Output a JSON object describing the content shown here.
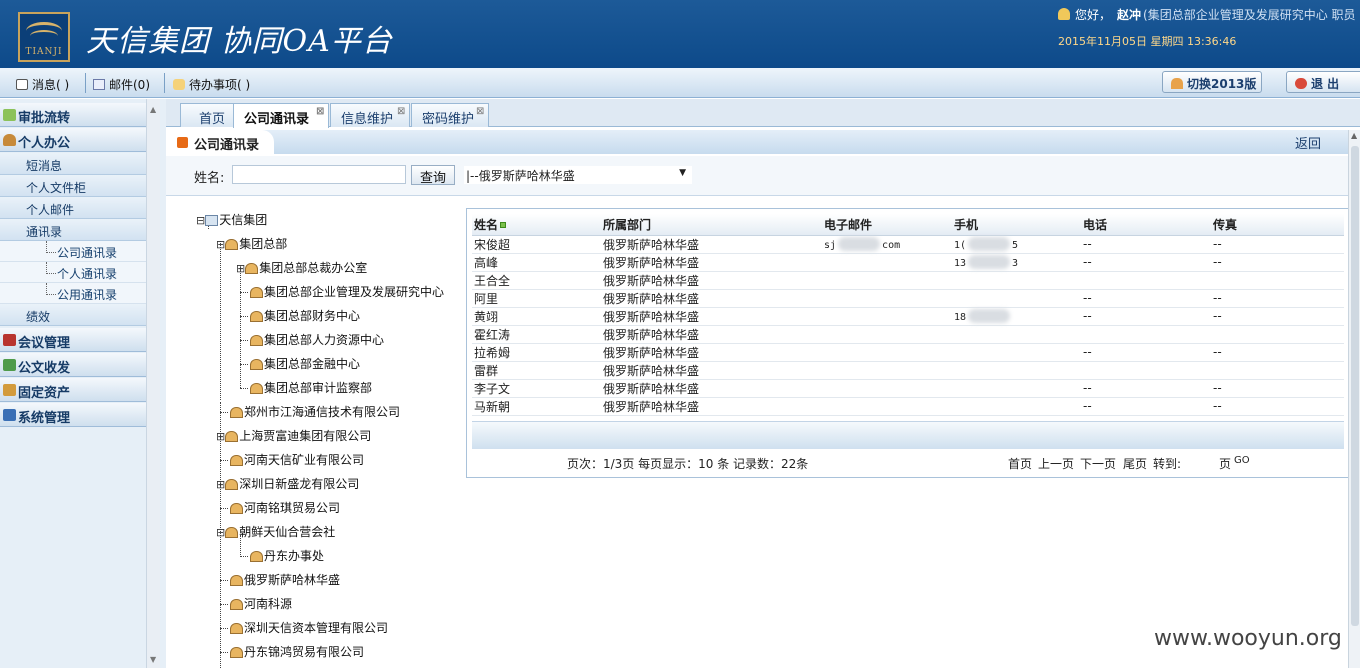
{
  "header": {
    "logo_text": "TIANJI",
    "title": "天信集团  协同OA平台",
    "greeting": "您好，",
    "user": "赵冲",
    "org": "(集团总部企业管理及发展研究中心  职员",
    "datetime": "2015年11月05日 星期四 13:36:46"
  },
  "toolbar": {
    "messages": "消息(  )",
    "mail": "邮件(0)",
    "todo": "待办事项(  )",
    "switch_version": "切换2013版",
    "logout": "退  出"
  },
  "sidebar": {
    "approval": "审批流转",
    "personal": "个人办公",
    "short_msg": "短消息",
    "personal_files": "个人文件柜",
    "personal_mail": "个人邮件",
    "contacts": "通讯录",
    "contacts_company": "公司通讯录",
    "contacts_personal": "个人通讯录",
    "contacts_public": "公用通讯录",
    "performance": "绩效",
    "meeting": "会议管理",
    "documents": "公文收发",
    "assets": "固定资产",
    "system": "系统管理"
  },
  "tabs": [
    "首页",
    "公司通讯录",
    "信息维护",
    "密码维护"
  ],
  "panel": {
    "title": "公司通讯录",
    "back": "返回",
    "name_label": "姓名:",
    "name_value": "",
    "query_button": "查询",
    "dept_select": "|--俄罗斯萨哈林华盛"
  },
  "tree": {
    "root": "天信集团",
    "hq": "集团总部",
    "hq_president_office": "集团总部总裁办公室",
    "hq_enterprise_mgmt": "集团总部企业管理及发展研究中心",
    "hq_finance": "集团总部财务中心",
    "hq_hr": "集团总部人力资源中心",
    "hq_financial": "集团总部金融中心",
    "hq_audit": "集团总部审计监察部",
    "zhengzhou": "郑州市江海通信技术有限公司",
    "shanghai": "上海贾富迪集团有限公司",
    "henan_mining": "河南天信矿业有限公司",
    "shenzhen_xsl": "深圳日新盛龙有限公司",
    "henan_mq": "河南铭琪贸易公司",
    "dprk": "朝鲜天仙合营会社",
    "dandong_office": "丹东办事处",
    "russia": "俄罗斯萨哈林华盛",
    "henan_keyuan": "河南科源",
    "shenzhen_capital": "深圳天信资本管理有限公司",
    "dandong_trade": "丹东锦鸿贸易有限公司"
  },
  "grid": {
    "columns": [
      "姓名",
      "所属部门",
      "电子邮件",
      "手机",
      "电话",
      "传真"
    ],
    "rows": [
      {
        "name": "宋俊超",
        "dept": "俄罗斯萨哈林华盛",
        "email_a": "sj",
        "email_b": "com",
        "mobile_a": "1(",
        "mobile_b": "5",
        "phone": "--",
        "fax": "--"
      },
      {
        "name": "高峰",
        "dept": "俄罗斯萨哈林华盛",
        "email_a": "",
        "email_b": "",
        "mobile_a": "13",
        "mobile_b": "3",
        "phone": "--",
        "fax": "--"
      },
      {
        "name": "王合全",
        "dept": "俄罗斯萨哈林华盛",
        "email_a": "",
        "email_b": "",
        "mobile_a": "",
        "mobile_b": "",
        "phone": "",
        "fax": ""
      },
      {
        "name": "阿里",
        "dept": "俄罗斯萨哈林华盛",
        "email_a": "",
        "email_b": "",
        "mobile_a": "",
        "mobile_b": "",
        "phone": "--",
        "fax": "--"
      },
      {
        "name": "黄翊",
        "dept": "俄罗斯萨哈林华盛",
        "email_a": "",
        "email_b": "",
        "mobile_a": "18",
        "mobile_b": "",
        "phone": "--",
        "fax": "--"
      },
      {
        "name": "霍红涛",
        "dept": "俄罗斯萨哈林华盛",
        "email_a": "",
        "email_b": "",
        "mobile_a": "",
        "mobile_b": "",
        "phone": "",
        "fax": ""
      },
      {
        "name": "拉希姆",
        "dept": "俄罗斯萨哈林华盛",
        "email_a": "",
        "email_b": "",
        "mobile_a": "",
        "mobile_b": "",
        "phone": "--",
        "fax": "--"
      },
      {
        "name": "雷群",
        "dept": "俄罗斯萨哈林华盛",
        "email_a": "",
        "email_b": "",
        "mobile_a": "",
        "mobile_b": "",
        "phone": "",
        "fax": ""
      },
      {
        "name": "李子文",
        "dept": "俄罗斯萨哈林华盛",
        "email_a": "",
        "email_b": "",
        "mobile_a": "",
        "mobile_b": "",
        "phone": "--",
        "fax": "--"
      },
      {
        "name": "马新朝",
        "dept": "俄罗斯萨哈林华盛",
        "email_a": "",
        "email_b": "",
        "mobile_a": "",
        "mobile_b": "",
        "phone": "--",
        "fax": "--"
      }
    ]
  },
  "pager": {
    "page_info": "页次：1/3页  每页显示：10   条  记录数：22条",
    "first": "首页",
    "prev": "上一页",
    "next": "下一页",
    "last": "尾页",
    "goto": "转到:",
    "page_unit": "页",
    "go": "GO"
  },
  "watermark": "www.wooyun.org"
}
